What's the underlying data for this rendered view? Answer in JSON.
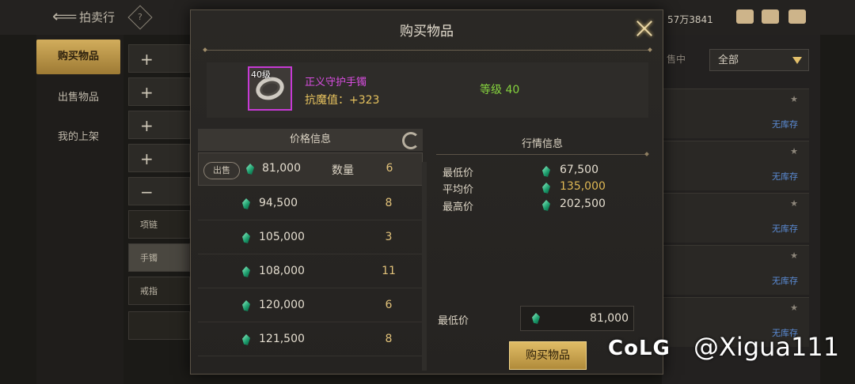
{
  "background": {
    "title": "拍卖行",
    "help": "?",
    "currency": "57万3841",
    "sidebar": [
      "购买物品",
      "出售物品",
      "我的上架"
    ],
    "categories": [
      "+",
      "+",
      "+",
      "+",
      "−",
      "项链",
      "手镯",
      "戒指"
    ],
    "filter_label": "售中",
    "filter_select": "全部",
    "no_stock": "无库存",
    "star": "★"
  },
  "modal": {
    "title": "购买物品",
    "item": {
      "level_tag": "40级",
      "name": "正义守护手镯",
      "stat": "抗魔值：+323",
      "grade": "等级 40"
    },
    "price_info": {
      "header": "价格信息",
      "sell_tag": "出售",
      "qty_label": "数量",
      "rows": [
        {
          "price": "81,000",
          "qty": "6"
        },
        {
          "price": "94,500",
          "qty": "8"
        },
        {
          "price": "105,000",
          "qty": "3"
        },
        {
          "price": "108,000",
          "qty": "11"
        },
        {
          "price": "120,000",
          "qty": "6"
        },
        {
          "price": "121,500",
          "qty": "8"
        }
      ]
    },
    "market_info": {
      "header": "行情信息",
      "min_label": "最低价",
      "min_value": "67,500",
      "avg_label": "平均价",
      "avg_value": "135,000",
      "max_label": "最高价",
      "max_value": "202,500"
    },
    "buy": {
      "min_price_label": "最低价",
      "min_price_value": "81,000",
      "button": "购买物品"
    }
  },
  "watermark": {
    "logo": "CoLG",
    "user": "@Xigua111"
  }
}
